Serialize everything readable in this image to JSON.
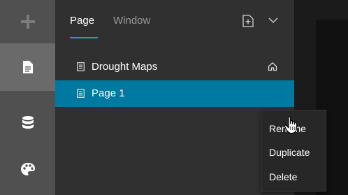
{
  "sidebar": {
    "items": [
      {
        "icon": "plus-icon"
      },
      {
        "icon": "page-icon",
        "active": true
      },
      {
        "icon": "database-icon"
      },
      {
        "icon": "palette-icon"
      }
    ]
  },
  "panel": {
    "tabs": [
      {
        "label": "Page",
        "active": true
      },
      {
        "label": "Window",
        "active": false
      }
    ],
    "header_icons": [
      "add-page-icon",
      "chevron-down-icon"
    ],
    "pages": [
      {
        "label": "Drought Maps",
        "icon": "document-icon",
        "home_icon": "home-icon",
        "selected": false
      },
      {
        "label": "Page 1",
        "icon": "document-icon",
        "selected": true
      }
    ]
  },
  "context_menu": {
    "items": [
      "Rename",
      "Duplicate",
      "Delete"
    ]
  },
  "colors": {
    "accent": "#0079a1",
    "tab_underline": "#1f9bbd",
    "rail": "#505050",
    "panel": "#303030"
  }
}
